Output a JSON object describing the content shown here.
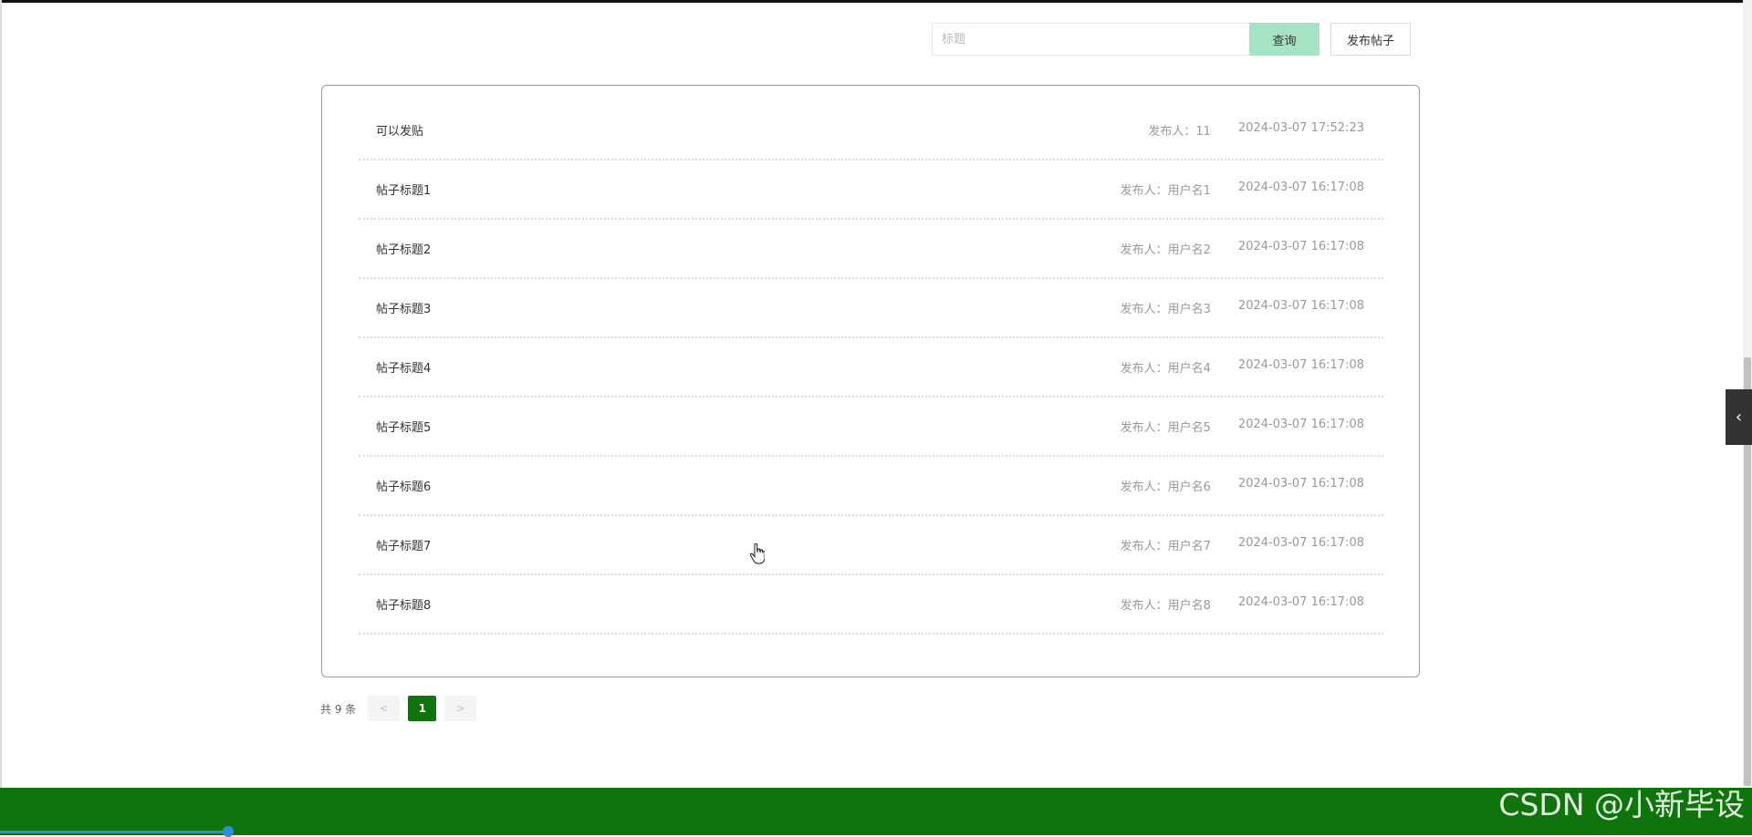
{
  "search": {
    "placeholder": "标题",
    "query_label": "查询",
    "publish_label": "发布帖子"
  },
  "posts": [
    {
      "title": "可以发贴",
      "author": "发布人：11",
      "time": "2024-03-07 17:52:23"
    },
    {
      "title": "帖子标题1",
      "author": "发布人：用户名1",
      "time": "2024-03-07 16:17:08"
    },
    {
      "title": "帖子标题2",
      "author": "发布人：用户名2",
      "time": "2024-03-07 16:17:08"
    },
    {
      "title": "帖子标题3",
      "author": "发布人：用户名3",
      "time": "2024-03-07 16:17:08"
    },
    {
      "title": "帖子标题4",
      "author": "发布人：用户名4",
      "time": "2024-03-07 16:17:08"
    },
    {
      "title": "帖子标题5",
      "author": "发布人：用户名5",
      "time": "2024-03-07 16:17:08"
    },
    {
      "title": "帖子标题6",
      "author": "发布人：用户名6",
      "time": "2024-03-07 16:17:08"
    },
    {
      "title": "帖子标题7",
      "author": "发布人：用户名7",
      "time": "2024-03-07 16:17:08"
    },
    {
      "title": "帖子标题8",
      "author": "发布人：用户名8",
      "time": "2024-03-07 16:17:08"
    }
  ],
  "pagination": {
    "total_text": "共 9 条",
    "prev": "<",
    "current": "1",
    "next": ">"
  },
  "side_toggle": {
    "icon": "chevron-left-icon",
    "glyph": "‹"
  },
  "watermark": "CSDN @小新毕设",
  "colors": {
    "accent": "#0f740c",
    "query_button": "#a6e3c2"
  }
}
